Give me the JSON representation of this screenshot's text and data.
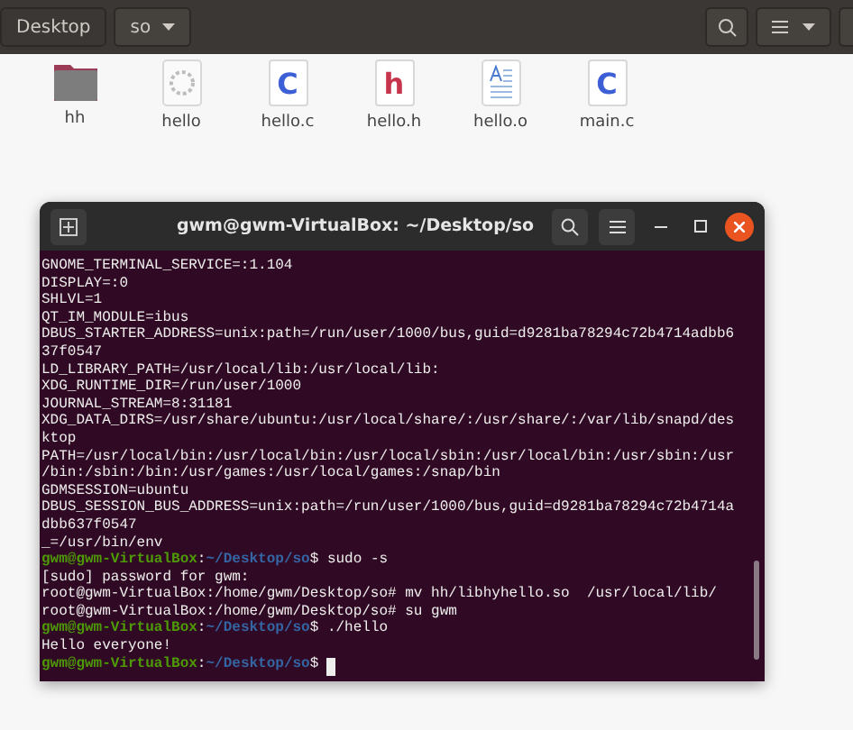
{
  "toolbar": {
    "breadcrumbs": [
      {
        "label": "Desktop",
        "selected": false
      },
      {
        "label": "so",
        "selected": true
      }
    ]
  },
  "files": [
    {
      "name": "hh",
      "kind": "folder"
    },
    {
      "name": "hello",
      "kind": "executable"
    },
    {
      "name": "hello.c",
      "kind": "source",
      "glyph": "C",
      "color": "#3d5fd6"
    },
    {
      "name": "hello.h",
      "kind": "source",
      "glyph": "h",
      "color": "#c7354d"
    },
    {
      "name": "hello.o",
      "kind": "document"
    },
    {
      "name": "main.c",
      "kind": "source",
      "glyph": "C",
      "color": "#3d5fd6"
    }
  ],
  "terminal": {
    "title": "gwm@gwm-VirtualBox: ~/Desktop/so",
    "cursor_visible": true,
    "lines": [
      {
        "kind": "output",
        "text": "GNOME_TERMINAL_SERVICE=:1.104"
      },
      {
        "kind": "output",
        "text": "DISPLAY=:0"
      },
      {
        "kind": "output",
        "text": "SHLVL=1"
      },
      {
        "kind": "output",
        "text": "QT_IM_MODULE=ibus"
      },
      {
        "kind": "output",
        "text": "DBUS_STARTER_ADDRESS=unix:path=/run/user/1000/bus,guid=d9281ba78294c72b4714adbb6"
      },
      {
        "kind": "output",
        "text": "37f0547"
      },
      {
        "kind": "output",
        "text": "LD_LIBRARY_PATH=/usr/local/lib:/usr/local/lib:"
      },
      {
        "kind": "output",
        "text": "XDG_RUNTIME_DIR=/run/user/1000"
      },
      {
        "kind": "output",
        "text": "JOURNAL_STREAM=8:31181"
      },
      {
        "kind": "output",
        "text": "XDG_DATA_DIRS=/usr/share/ubuntu:/usr/local/share/:/usr/share/:/var/lib/snapd/des"
      },
      {
        "kind": "output",
        "text": "ktop"
      },
      {
        "kind": "output",
        "text": "PATH=/usr/local/bin:/usr/local/bin:/usr/local/sbin:/usr/local/bin:/usr/sbin:/usr"
      },
      {
        "kind": "output",
        "text": "/bin:/sbin:/bin:/usr/games:/usr/local/games:/snap/bin"
      },
      {
        "kind": "output",
        "text": "GDMSESSION=ubuntu"
      },
      {
        "kind": "output",
        "text": "DBUS_SESSION_BUS_ADDRESS=unix:path=/run/user/1000/bus,guid=d9281ba78294c72b4714a"
      },
      {
        "kind": "output",
        "text": "dbb637f0547"
      },
      {
        "kind": "output",
        "text": "_=/usr/bin/env"
      },
      {
        "kind": "prompt",
        "user": "gwm@gwm-VirtualBox",
        "separator": ":",
        "path": "~/Desktop/so",
        "command": "$ sudo -s"
      },
      {
        "kind": "output",
        "text": "[sudo] password for gwm:"
      },
      {
        "kind": "output",
        "text": "root@gwm-VirtualBox:/home/gwm/Desktop/so# mv hh/libhyhello.so  /usr/local/lib/"
      },
      {
        "kind": "output",
        "text": "root@gwm-VirtualBox:/home/gwm/Desktop/so# su gwm"
      },
      {
        "kind": "prompt",
        "user": "gwm@gwm-VirtualBox",
        "separator": ":",
        "path": "~/Desktop/so",
        "command": "$ ./hello"
      },
      {
        "kind": "output",
        "text": "Hello everyone!"
      },
      {
        "kind": "prompt",
        "user": "gwm@gwm-VirtualBox",
        "separator": ":",
        "path": "~/Desktop/so",
        "command": "$ "
      }
    ]
  }
}
